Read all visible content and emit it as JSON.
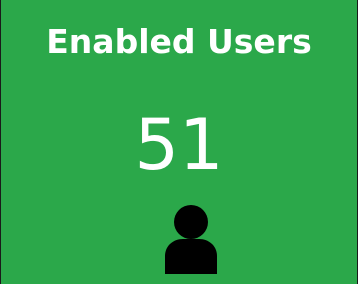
{
  "tile": {
    "title": "Enabled Users",
    "count": "51",
    "icon": "user-icon",
    "colors": {
      "background": "#2ba84a",
      "text": "#ffffff",
      "icon": "#000000"
    }
  }
}
